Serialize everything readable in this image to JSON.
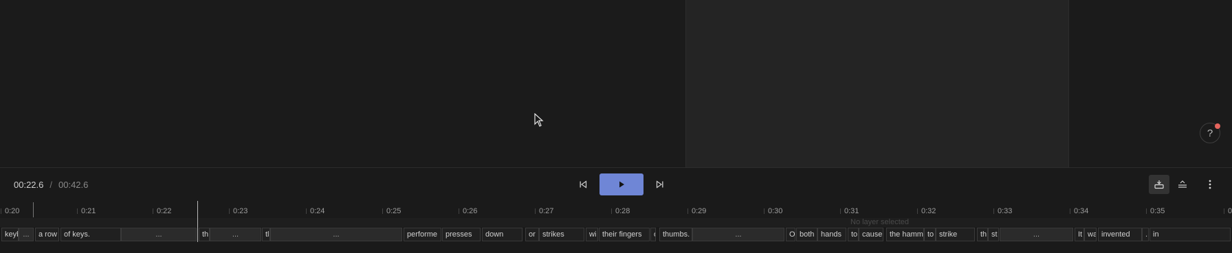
{
  "preview": {
    "no_layer_text": "No layer selected"
  },
  "help": {
    "label": "?"
  },
  "player": {
    "current_time": "00:22.6",
    "separator": "/",
    "total_time": "00:42.6"
  },
  "ruler": {
    "ticks": [
      "0:20",
      "0:21",
      "0:22",
      "0:23",
      "0:24",
      "0:25",
      "0:26",
      "0:27",
      "0:28",
      "0:29",
      "0:30",
      "0:31",
      "0:32",
      "0:33",
      "0:34",
      "0:35",
      "0"
    ]
  },
  "words": [
    "keyb",
    "...",
    "a row",
    "of keys.",
    "...",
    "th",
    "...",
    "tl",
    "...",
    "performe",
    "presses",
    "down",
    "or",
    "strikes",
    "wi",
    "their fingers",
    "o",
    "thumbs.",
    "...",
    "O",
    "both",
    "hands",
    "to",
    "cause",
    "the hamm",
    "to",
    "strike",
    "th",
    "st",
    "...",
    "It",
    "wa",
    "invented",
    ".",
    "in"
  ],
  "colors": {
    "accent": "#6f86d6",
    "notification": "#e5645d",
    "background": "#1a1a1a"
  },
  "icons": [
    "cursor-icon",
    "help-icon",
    "skip-back-icon",
    "play-icon",
    "skip-forward-icon",
    "fit-timeline-icon",
    "collapse-icon",
    "more-vertical-icon"
  ]
}
